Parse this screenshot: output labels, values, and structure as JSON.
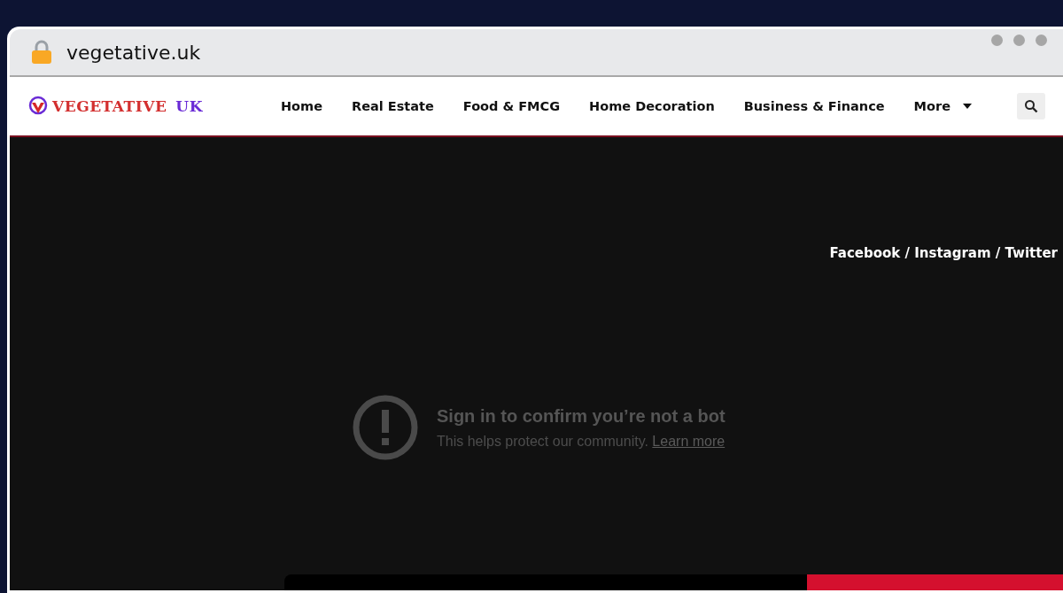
{
  "browser": {
    "url": "vegetative.uk"
  },
  "site": {
    "logo": {
      "word": "VEGETATIVE",
      "suffix": "UK"
    },
    "nav": [
      {
        "label": "Home",
        "kind": "link"
      },
      {
        "label": "Real Estate",
        "kind": "link"
      },
      {
        "label": "Food & FMCG",
        "kind": "link"
      },
      {
        "label": "Home Decoration",
        "kind": "link"
      },
      {
        "label": "Business & Finance",
        "kind": "link"
      },
      {
        "label": "More",
        "kind": "dropdown"
      }
    ]
  },
  "hero": {
    "social": "Facebook / Instagram / Twitter",
    "notice": {
      "title": "Sign in to confirm you’re not a bot",
      "text": "This helps protect our community.",
      "link": "Learn more"
    }
  }
}
